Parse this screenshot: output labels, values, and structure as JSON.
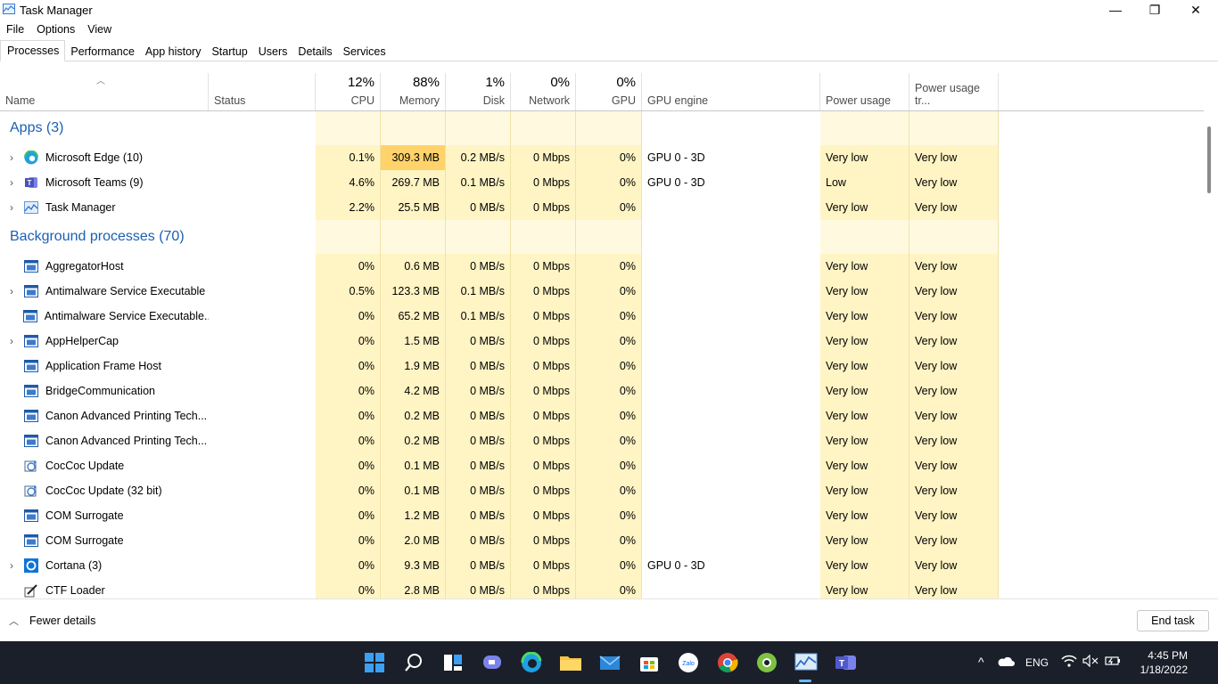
{
  "window": {
    "title": "Task Manager",
    "minimize_glyph": "—",
    "restore_glyph": "❐",
    "close_glyph": "✕"
  },
  "menu": [
    "File",
    "Options",
    "View"
  ],
  "tabs": [
    "Processes",
    "Performance",
    "App history",
    "Startup",
    "Users",
    "Details",
    "Services"
  ],
  "active_tab": "Processes",
  "columns": {
    "name": "Name",
    "status": "Status",
    "cpu": {
      "pct": "12%",
      "label": "CPU"
    },
    "memory": {
      "pct": "88%",
      "label": "Memory"
    },
    "disk": {
      "pct": "1%",
      "label": "Disk"
    },
    "network": {
      "pct": "0%",
      "label": "Network"
    },
    "gpu": {
      "pct": "0%",
      "label": "GPU"
    },
    "gpu_engine": "GPU engine",
    "power": "Power usage",
    "power_trend": "Power usage tr..."
  },
  "groups": {
    "apps": "Apps (3)",
    "background": "Background processes (70)"
  },
  "apps": [
    {
      "name": "Microsoft Edge (10)",
      "icon": "edge-icon",
      "expand": true,
      "cpu": "0.1%",
      "mem": "309.3 MB",
      "disk": "0.2 MB/s",
      "net": "0 Mbps",
      "gpu": "0%",
      "engine": "GPU 0 - 3D",
      "power": "Very low",
      "trend": "Very low"
    },
    {
      "name": "Microsoft Teams (9)",
      "icon": "teams-icon",
      "expand": true,
      "cpu": "4.6%",
      "mem": "269.7 MB",
      "disk": "0.1 MB/s",
      "net": "0 Mbps",
      "gpu": "0%",
      "engine": "GPU 0 - 3D",
      "power": "Low",
      "trend": "Very low"
    },
    {
      "name": "Task Manager",
      "icon": "taskmanager-icon",
      "expand": true,
      "cpu": "2.2%",
      "mem": "25.5 MB",
      "disk": "0 MB/s",
      "net": "0 Mbps",
      "gpu": "0%",
      "engine": "",
      "power": "Very low",
      "trend": "Very low"
    }
  ],
  "background": [
    {
      "name": "AggregatorHost",
      "icon": "window-icon",
      "expand": false,
      "cpu": "0%",
      "mem": "0.6 MB",
      "disk": "0 MB/s",
      "net": "0 Mbps",
      "gpu": "0%",
      "engine": "",
      "power": "Very low",
      "trend": "Very low"
    },
    {
      "name": "Antimalware Service Executable",
      "icon": "window-icon",
      "expand": true,
      "cpu": "0.5%",
      "mem": "123.3 MB",
      "disk": "0.1 MB/s",
      "net": "0 Mbps",
      "gpu": "0%",
      "engine": "",
      "power": "Very low",
      "trend": "Very low"
    },
    {
      "name": "Antimalware Service Executable...",
      "icon": "window-icon",
      "expand": false,
      "cpu": "0%",
      "mem": "65.2 MB",
      "disk": "0.1 MB/s",
      "net": "0 Mbps",
      "gpu": "0%",
      "engine": "",
      "power": "Very low",
      "trend": "Very low"
    },
    {
      "name": "AppHelperCap",
      "icon": "window-icon",
      "expand": true,
      "cpu": "0%",
      "mem": "1.5 MB",
      "disk": "0 MB/s",
      "net": "0 Mbps",
      "gpu": "0%",
      "engine": "",
      "power": "Very low",
      "trend": "Very low"
    },
    {
      "name": "Application Frame Host",
      "icon": "window-icon",
      "expand": false,
      "cpu": "0%",
      "mem": "1.9 MB",
      "disk": "0 MB/s",
      "net": "0 Mbps",
      "gpu": "0%",
      "engine": "",
      "power": "Very low",
      "trend": "Very low"
    },
    {
      "name": "BridgeCommunication",
      "icon": "window-icon",
      "expand": false,
      "cpu": "0%",
      "mem": "4.2 MB",
      "disk": "0 MB/s",
      "net": "0 Mbps",
      "gpu": "0%",
      "engine": "",
      "power": "Very low",
      "trend": "Very low"
    },
    {
      "name": "Canon Advanced Printing Tech...",
      "icon": "window-icon",
      "expand": false,
      "cpu": "0%",
      "mem": "0.2 MB",
      "disk": "0 MB/s",
      "net": "0 Mbps",
      "gpu": "0%",
      "engine": "",
      "power": "Very low",
      "trend": "Very low"
    },
    {
      "name": "Canon Advanced Printing Tech...",
      "icon": "window-icon",
      "expand": false,
      "cpu": "0%",
      "mem": "0.2 MB",
      "disk": "0 MB/s",
      "net": "0 Mbps",
      "gpu": "0%",
      "engine": "",
      "power": "Very low",
      "trend": "Very low"
    },
    {
      "name": "CocCoc Update",
      "icon": "update-icon",
      "expand": false,
      "cpu": "0%",
      "mem": "0.1 MB",
      "disk": "0 MB/s",
      "net": "0 Mbps",
      "gpu": "0%",
      "engine": "",
      "power": "Very low",
      "trend": "Very low"
    },
    {
      "name": "CocCoc Update (32 bit)",
      "icon": "update-icon",
      "expand": false,
      "cpu": "0%",
      "mem": "0.1 MB",
      "disk": "0 MB/s",
      "net": "0 Mbps",
      "gpu": "0%",
      "engine": "",
      "power": "Very low",
      "trend": "Very low"
    },
    {
      "name": "COM Surrogate",
      "icon": "window-icon",
      "expand": false,
      "cpu": "0%",
      "mem": "1.2 MB",
      "disk": "0 MB/s",
      "net": "0 Mbps",
      "gpu": "0%",
      "engine": "",
      "power": "Very low",
      "trend": "Very low"
    },
    {
      "name": "COM Surrogate",
      "icon": "window-icon",
      "expand": false,
      "cpu": "0%",
      "mem": "2.0 MB",
      "disk": "0 MB/s",
      "net": "0 Mbps",
      "gpu": "0%",
      "engine": "",
      "power": "Very low",
      "trend": "Very low"
    },
    {
      "name": "Cortana (3)",
      "icon": "cortana-icon",
      "expand": true,
      "cpu": "0%",
      "mem": "9.3 MB",
      "disk": "0 MB/s",
      "net": "0 Mbps",
      "gpu": "0%",
      "engine": "GPU 0 - 3D",
      "power": "Very low",
      "trend": "Very low"
    },
    {
      "name": "CTF Loader",
      "icon": "pen-icon",
      "expand": false,
      "cpu": "0%",
      "mem": "2.8 MB",
      "disk": "0 MB/s",
      "net": "0 Mbps",
      "gpu": "0%",
      "engine": "",
      "power": "Very low",
      "trend": "Very low"
    }
  ],
  "footer": {
    "fewer_details": "Fewer details",
    "end_task": "End task"
  },
  "taskbar": {
    "lang": "ENG",
    "time": "4:45 PM",
    "date": "1/18/2022",
    "caret": "^",
    "zalo_label": "Zalo"
  },
  "colors": {
    "accent": "#1a5fb4",
    "cell_bg": "#fff4c4",
    "cell_hot": "#ffd26a",
    "taskbar": "#1b1f2a"
  }
}
